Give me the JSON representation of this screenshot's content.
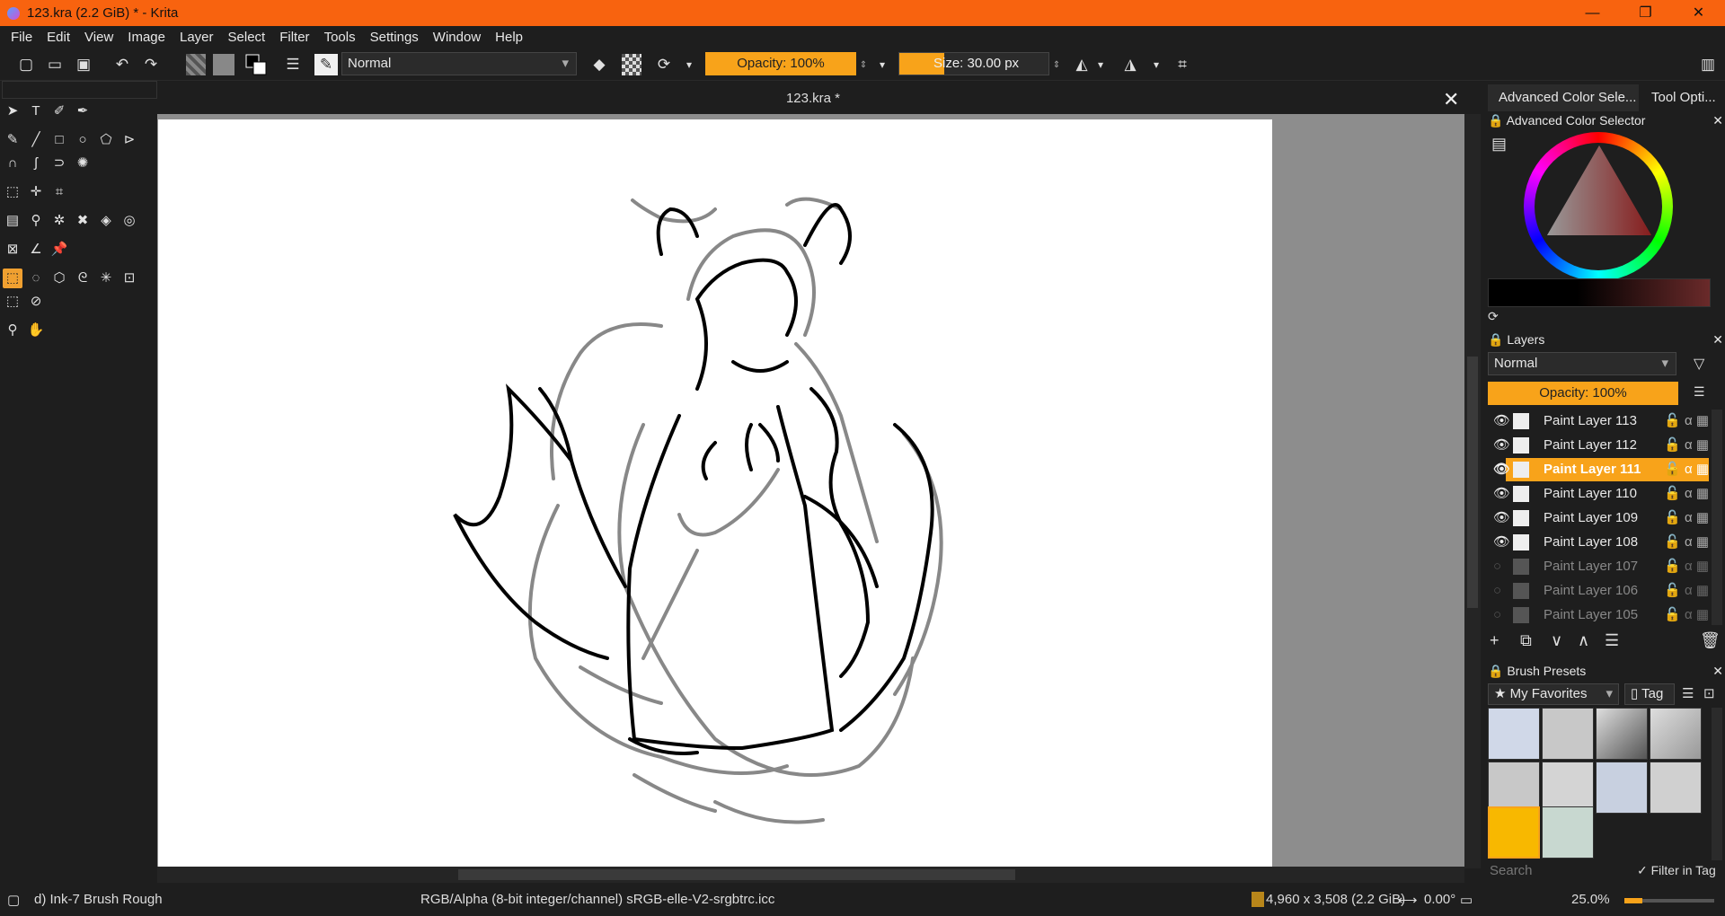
{
  "window": {
    "title": "123.kra (2.2 GiB)  * - Krita",
    "min": "—",
    "max": "❐",
    "close": "✕"
  },
  "menu": [
    "File",
    "Edit",
    "View",
    "Image",
    "Layer",
    "Select",
    "Filter",
    "Tools",
    "Settings",
    "Window",
    "Help"
  ],
  "toolbar": {
    "blend_mode": "Normal",
    "opacity_label": "Opacity: 100%",
    "size_label": "Size: 30.00 px"
  },
  "document": {
    "tab_title": "123.kra *",
    "close": "✕"
  },
  "dock": {
    "tabs": [
      "Advanced Color Sele...",
      "Tool Opti..."
    ],
    "color_selector_title": "Advanced Color Selector",
    "layers_title": "Layers",
    "layers_blend": "Normal",
    "layers_opacity": "Opacity:  100%",
    "layers": [
      {
        "name": "Paint Layer 113",
        "visible": true,
        "active": false
      },
      {
        "name": "Paint Layer 112",
        "visible": true,
        "active": false
      },
      {
        "name": "Paint Layer 111",
        "visible": true,
        "active": true
      },
      {
        "name": "Paint Layer 110",
        "visible": true,
        "active": false
      },
      {
        "name": "Paint Layer 109",
        "visible": true,
        "active": false
      },
      {
        "name": "Paint Layer 108",
        "visible": true,
        "active": false
      },
      {
        "name": "Paint Layer 107",
        "visible": false,
        "active": false
      },
      {
        "name": "Paint Layer 106",
        "visible": false,
        "active": false
      },
      {
        "name": "Paint Layer 105",
        "visible": false,
        "active": false
      }
    ],
    "brush_presets_title": "Brush Presets",
    "brush_filter": "My Favorites",
    "tag_label": "Tag",
    "search_placeholder": "Search",
    "filter_in_tag": "Filter in Tag"
  },
  "status": {
    "brush": "d) Ink-7 Brush Rough",
    "color_model": "RGB/Alpha (8-bit integer/channel)  sRGB-elle-V2-srgbtrc.icc",
    "dimensions": "4,960 x 3,508 (2.2 GiB)",
    "rotation": "0.00°",
    "zoom": "25.0%"
  },
  "colors": {
    "accent": "#f8a31a",
    "titlebar": "#f8630f"
  }
}
